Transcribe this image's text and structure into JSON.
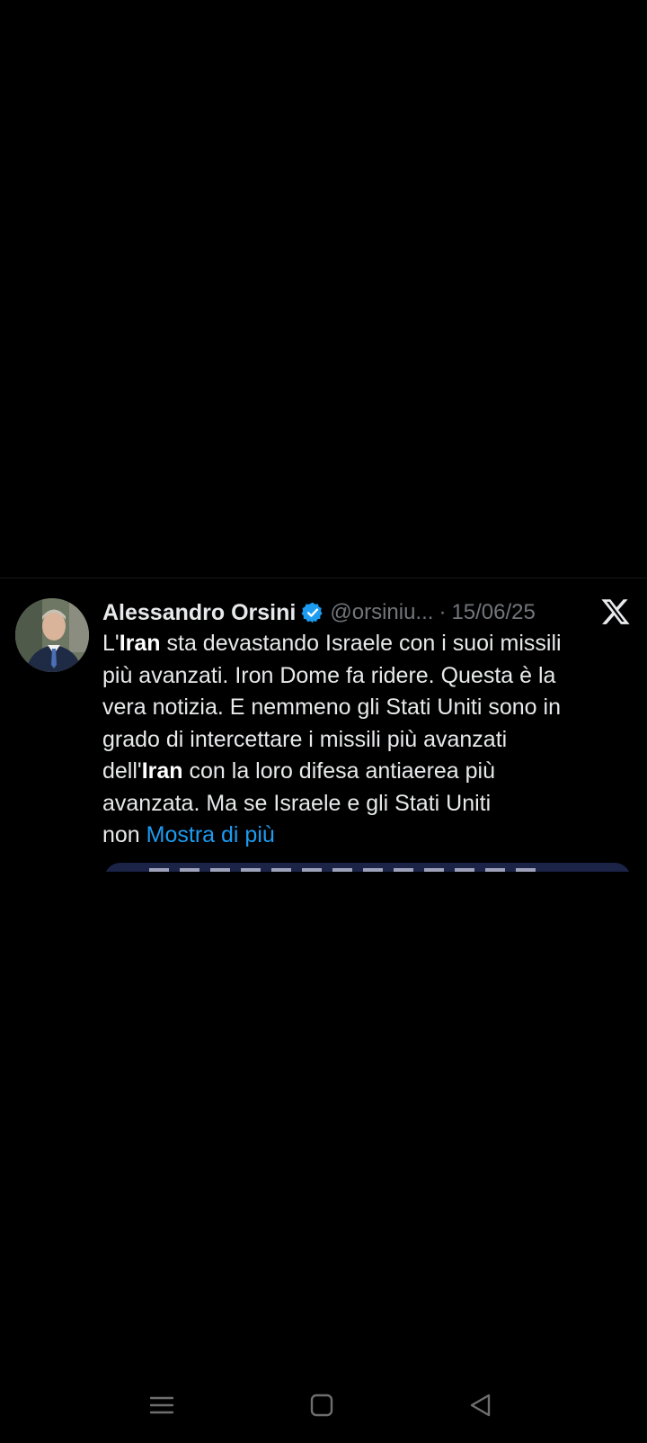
{
  "tweet": {
    "author_name": "Alessandro Orsini",
    "handle": "@orsiniu...",
    "separator": "·",
    "date": "15/06/25",
    "text_lines": [
      [
        {
          "t": "L'",
          "b": false
        },
        {
          "t": "Iran",
          "b": true
        },
        {
          "t": " sta devastando Israele con i suoi missili",
          "b": false
        }
      ],
      [
        {
          "t": "più avanzati. Iron Dome fa ridere. Questa è la",
          "b": false
        }
      ],
      [
        {
          "t": "vera notizia. E nemmeno gli Stati Uniti sono in",
          "b": false
        }
      ],
      [
        {
          "t": "grado di intercettare i missili più avanzati",
          "b": false
        }
      ],
      [
        {
          "t": "dell'",
          "b": false
        },
        {
          "t": "Iran",
          "b": true
        },
        {
          "t": " con la loro difesa antiaerea più",
          "b": false
        }
      ],
      [
        {
          "t": "avanzata. Ma se Israele e gli Stati Uniti",
          "b": false
        }
      ],
      [
        {
          "t": "non ",
          "b": false
        }
      ]
    ],
    "show_more": "Mostra di più"
  },
  "icons": {
    "verified": "verified-badge-icon",
    "brand": "x-logo-icon",
    "nav": [
      "menu-icon",
      "home-square-icon",
      "back-triangle-icon"
    ]
  },
  "colors": {
    "background": "#000000",
    "text": "#e7e9ea",
    "secondary": "#71767b",
    "link": "#1d9bf0",
    "verified": "#1d9bf0"
  }
}
